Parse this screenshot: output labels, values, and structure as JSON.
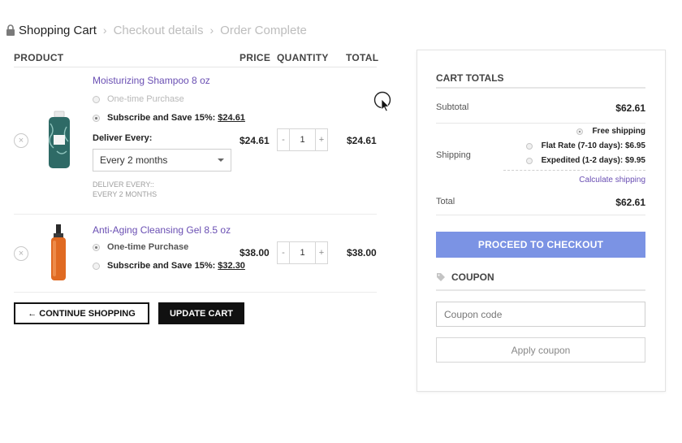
{
  "breadcrumb": {
    "steps": [
      "Shopping Cart",
      "Checkout details",
      "Order Complete"
    ]
  },
  "cart": {
    "headers": {
      "product": "PRODUCT",
      "price": "PRICE",
      "quantity": "QUANTITY",
      "total": "TOTAL"
    },
    "items": [
      {
        "name": "Moisturizing Shampoo 8 oz",
        "option_one_time": "One-time Purchase",
        "option_subscribe": "Subscribe and Save 15%:",
        "subscribe_price": "$24.61",
        "selected": "subscribe",
        "deliver_label": "Deliver Every:",
        "deliver_value": "Every 2 months",
        "deliver_note_1": "DELIVER EVERY::",
        "deliver_note_2": "EVERY 2 MONTHS",
        "price": "$24.61",
        "quantity": "1",
        "total": "$24.61"
      },
      {
        "name": "Anti-Aging Cleansing Gel 8.5 oz",
        "option_one_time": "One-time Purchase",
        "option_subscribe": "Subscribe and Save 15%:",
        "subscribe_price": "$32.30",
        "selected": "one_time",
        "price": "$38.00",
        "quantity": "1",
        "total": "$38.00"
      }
    ],
    "qty_minus": "-",
    "qty_plus": "+",
    "remove_glyph": "×",
    "continue_label": "← CONTINUE SHOPPING",
    "update_label": "UPDATE CART"
  },
  "totals": {
    "title": "CART TOTALS",
    "subtotal_label": "Subtotal",
    "subtotal": "$62.61",
    "shipping_label": "Shipping",
    "shipping_options": [
      "Free shipping",
      "Flat Rate (7-10 days): $6.95",
      "Expedited (1-2 days): $9.95"
    ],
    "shipping_selected": 0,
    "calculate_label": "Calculate shipping",
    "total_label": "Total",
    "total": "$62.61",
    "checkout_label": "PROCEED TO CHECKOUT"
  },
  "coupon": {
    "title": "COUPON",
    "placeholder": "Coupon code",
    "apply_label": "Apply coupon"
  },
  "colors": {
    "link": "#6a4fb3",
    "checkout_button": "#7b93e4",
    "dark_button": "#111111"
  }
}
